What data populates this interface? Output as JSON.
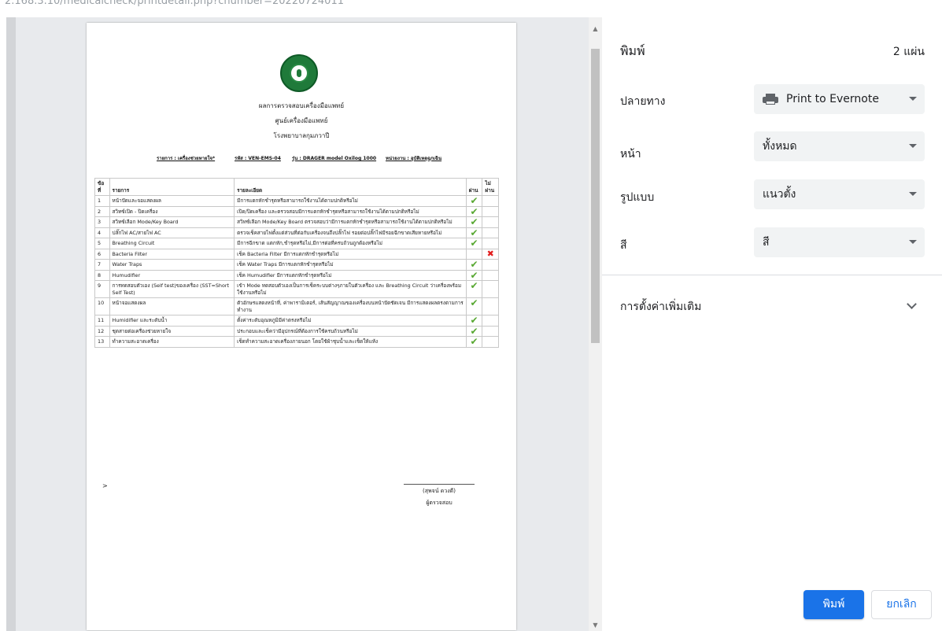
{
  "url_fragment": "2.168.3.10/medicalcheck/printdetail.php?cnumber=20220724011",
  "document": {
    "title_lines": [
      "ผลการตรวจสอบเครื่องมือแพทย์",
      "ศูนย์เครื่องมือแพทย์",
      "โรงพยาบาลกุมภวาปี"
    ],
    "meta": {
      "item": "รายการ : เครื่องช่วยหายใจ*",
      "code": "รหัส : VEN-EMS-04",
      "model": "รุ่น : DRAGER model Oxilog 1000",
      "unit": "หน่วยงาน : อุบัติเหตุฉุกเฉิน"
    },
    "table_headers": {
      "no": "ข้อที่",
      "item": "รายการ",
      "detail": "รายละเอียด",
      "pass": "ผ่าน",
      "fail": "ไม่ผ่าน"
    },
    "rows": [
      {
        "no": "1",
        "item": "หน้าปัดและจอแสดงผล",
        "detail": "มีการแตกหักชำรุดหรือสามารถใช้งานได้ตามปกติหรือไม่",
        "result": "pass"
      },
      {
        "no": "2",
        "item": "สวิทซ์เปิด - ปิดเครื่อง",
        "detail": "เปิด/ปิดเครื่อง และตรวจสอบมีการแตกหักชำรุดหรือสามารถใช้งานได้ตามปกติหรือไม่",
        "result": "pass"
      },
      {
        "no": "3",
        "item": "สวิทซ์เลือก Mode/Key Board",
        "detail": "สวิทซ์เลือก Mode/Key Board ตรวจสอบว่ามีการแตกหักชำรุดหรือสามารถใช้งานได้ตามปกติหรือไม่",
        "result": "pass"
      },
      {
        "no": "4",
        "item": "ปลั๊กไฟ AC/สายไฟ AC",
        "detail": "ตรวจเช็คสายไฟตั้งแต่ส่วนที่ต่อกับเครื่องจนถึงปลั๊กไฟ รอยต่อปลั๊กไฟมีรอยฉีกขาดเสียหายหรือไม่",
        "result": "pass"
      },
      {
        "no": "5",
        "item": "Breathing Circuit",
        "detail": "มีการฉีกขาด แตกหัก,ชำรุดหรือไม่,มีการต่อที่ครบถ้วนถูกต้องหรือไม่",
        "result": "pass"
      },
      {
        "no": "6",
        "item": "Bacteria Filter",
        "detail": "เช็ค Bacteria Filter มีการแตกหักชำรุดหรือไม่",
        "result": "fail"
      },
      {
        "no": "7",
        "item": "Water Traps",
        "detail": "เช็ค Water Traps มีการแตกหักชำรุดหรือไม่",
        "result": "pass"
      },
      {
        "no": "8",
        "item": "Humudifier",
        "detail": "เช็ค Humudifier มีการแตกหักชำรุดหรือไม่",
        "result": "pass"
      },
      {
        "no": "9",
        "item": "การทดสอบตัวเอง (Self test)ของเครื่อง (SST=Short Self Test)",
        "detail": "เข้า Mode ทดสอบตัวเองเป็นการเช็คระบบต่างๆภายในตัวเครื่อง และ Breathing Circuit ว่าเครื่องพร้อมใช้งานหรือไม่",
        "result": "pass"
      },
      {
        "no": "10",
        "item": "หน้าจอแสดงผล",
        "detail": "ตัวอักษรแสดงหน้าที่, ค่าพารามิเตอร์, เส้นสัญญาณของเครื่องบนหน้าปัดชัดเจน มีการแสดงผลตรงตามการทำงาน",
        "result": "pass"
      },
      {
        "no": "11",
        "item": "Humidifier และระดับน้ำ",
        "detail": "ตั้งค่าระดับอุณหภูมิมีค่าตรงหรือไม่",
        "result": "pass"
      },
      {
        "no": "12",
        "item": "ชุดสายต่อเครื่องช่วยหายใจ",
        "detail": "ประกอบและเช็คว่ามีอุปกรณ์ที่ต้องการใช้ครบถ้วนหรือไม่",
        "result": "pass"
      },
      {
        "no": "13",
        "item": "ทำความสะอาดเครื่อง",
        "detail": "เช็ดทำความสะอาดเครื่องภายนอก โดยใช้ผ้าชุบน้ำและเช็ดให้แห้ง",
        "result": "pass"
      }
    ],
    "pass_mark": "✔",
    "fail_mark": "✖",
    "gt_mark": ">",
    "signer_name": "(สุพจน์ ดวงดี)",
    "signer_role": "ผู้ตรวจสอบ"
  },
  "panel": {
    "title": "พิมพ์",
    "sheet_count": "2 แผ่น",
    "destination_label": "ปลายทาง",
    "destination_value": "Print to Evernote",
    "pages_label": "หน้า",
    "pages_value": "ทั้งหมด",
    "layout_label": "รูปแบบ",
    "layout_value": "แนวตั้ง",
    "color_label": "สี",
    "color_value": "สี",
    "more_settings": "การตั้งค่าเพิ่มเติม",
    "print_button": "พิมพ์",
    "cancel_button": "ยกเลิก"
  },
  "colors": {
    "accent": "#1a73e8",
    "pass": "#58a832",
    "fail": "#e21d1d",
    "seal": "#1f7a3a"
  }
}
